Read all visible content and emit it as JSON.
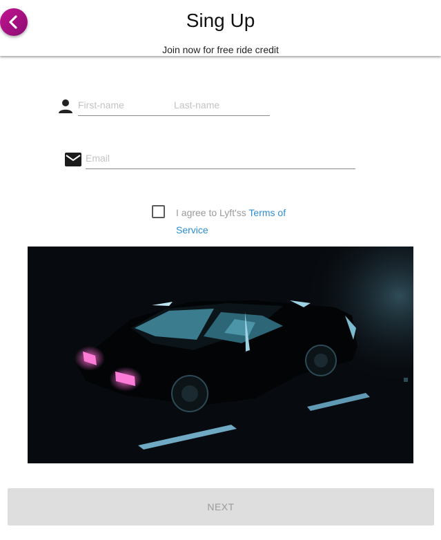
{
  "header": {
    "title": "Sing Up",
    "subtitle": "Join now for free ride credit",
    "back_icon": "chevron-left-icon"
  },
  "form": {
    "first_name_placeholder": "First-name",
    "last_name_placeholder": "Last-name",
    "email_placeholder": "Email",
    "person_icon": "person-icon",
    "mail_icon": "mail-icon"
  },
  "agreement": {
    "checked": false,
    "text": "I agree to Lyft'ss ",
    "terms_word1": "Terms of",
    "terms_word2": "Service"
  },
  "hero": {
    "image": "dark car at night with pink headlights"
  },
  "footer": {
    "next_label": "NEXT"
  },
  "colors": {
    "accent": "#b0137f",
    "link": "#2b8ed0",
    "disabled_button": "#dedede",
    "placeholder": "#c3c3c3"
  }
}
